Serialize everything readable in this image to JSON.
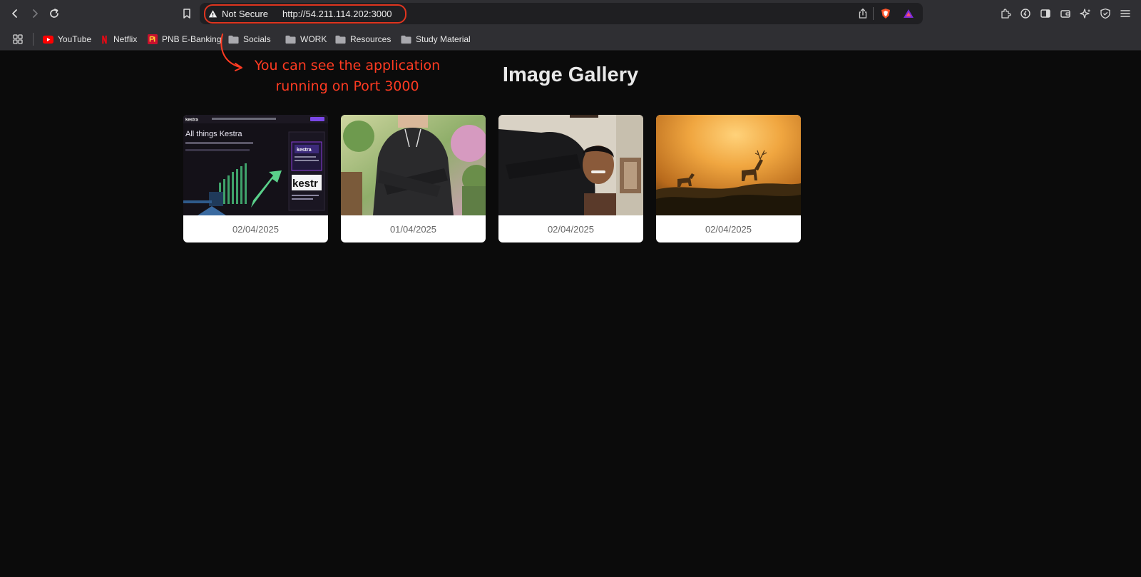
{
  "browser": {
    "security_label": "Not Secure",
    "url": "http://54.211.114.202:3000"
  },
  "bookmarks": [
    {
      "label": "YouTube",
      "icon": "youtube-icon",
      "color": "#ff0000"
    },
    {
      "label": "Netflix",
      "icon": "netflix-icon",
      "color": "#e50914"
    },
    {
      "label": "PNB E-Banking",
      "icon": "pnb-icon",
      "color": "#c8102e"
    },
    {
      "label": "Socials",
      "icon": "folder-icon"
    },
    {
      "label": "WORK",
      "icon": "folder-icon"
    },
    {
      "label": "Resources",
      "icon": "folder-icon"
    },
    {
      "label": "Study Material",
      "icon": "folder-icon"
    }
  ],
  "annotation": {
    "line1": "You can see the application",
    "line2": "running on Port 3000",
    "color": "#ff3b22"
  },
  "gallery": {
    "title": "Image Gallery",
    "items": [
      {
        "date": "02/04/2025",
        "image": "kestra-screenshot",
        "thumb_text": {
          "logo": "kestra",
          "heading": "All things Kestra",
          "card": "kestr"
        }
      },
      {
        "date": "01/04/2025",
        "image": "hoodie-illustration"
      },
      {
        "date": "02/04/2025",
        "image": "person-photo"
      },
      {
        "date": "02/04/2025",
        "image": "deer-sunset"
      }
    ]
  }
}
